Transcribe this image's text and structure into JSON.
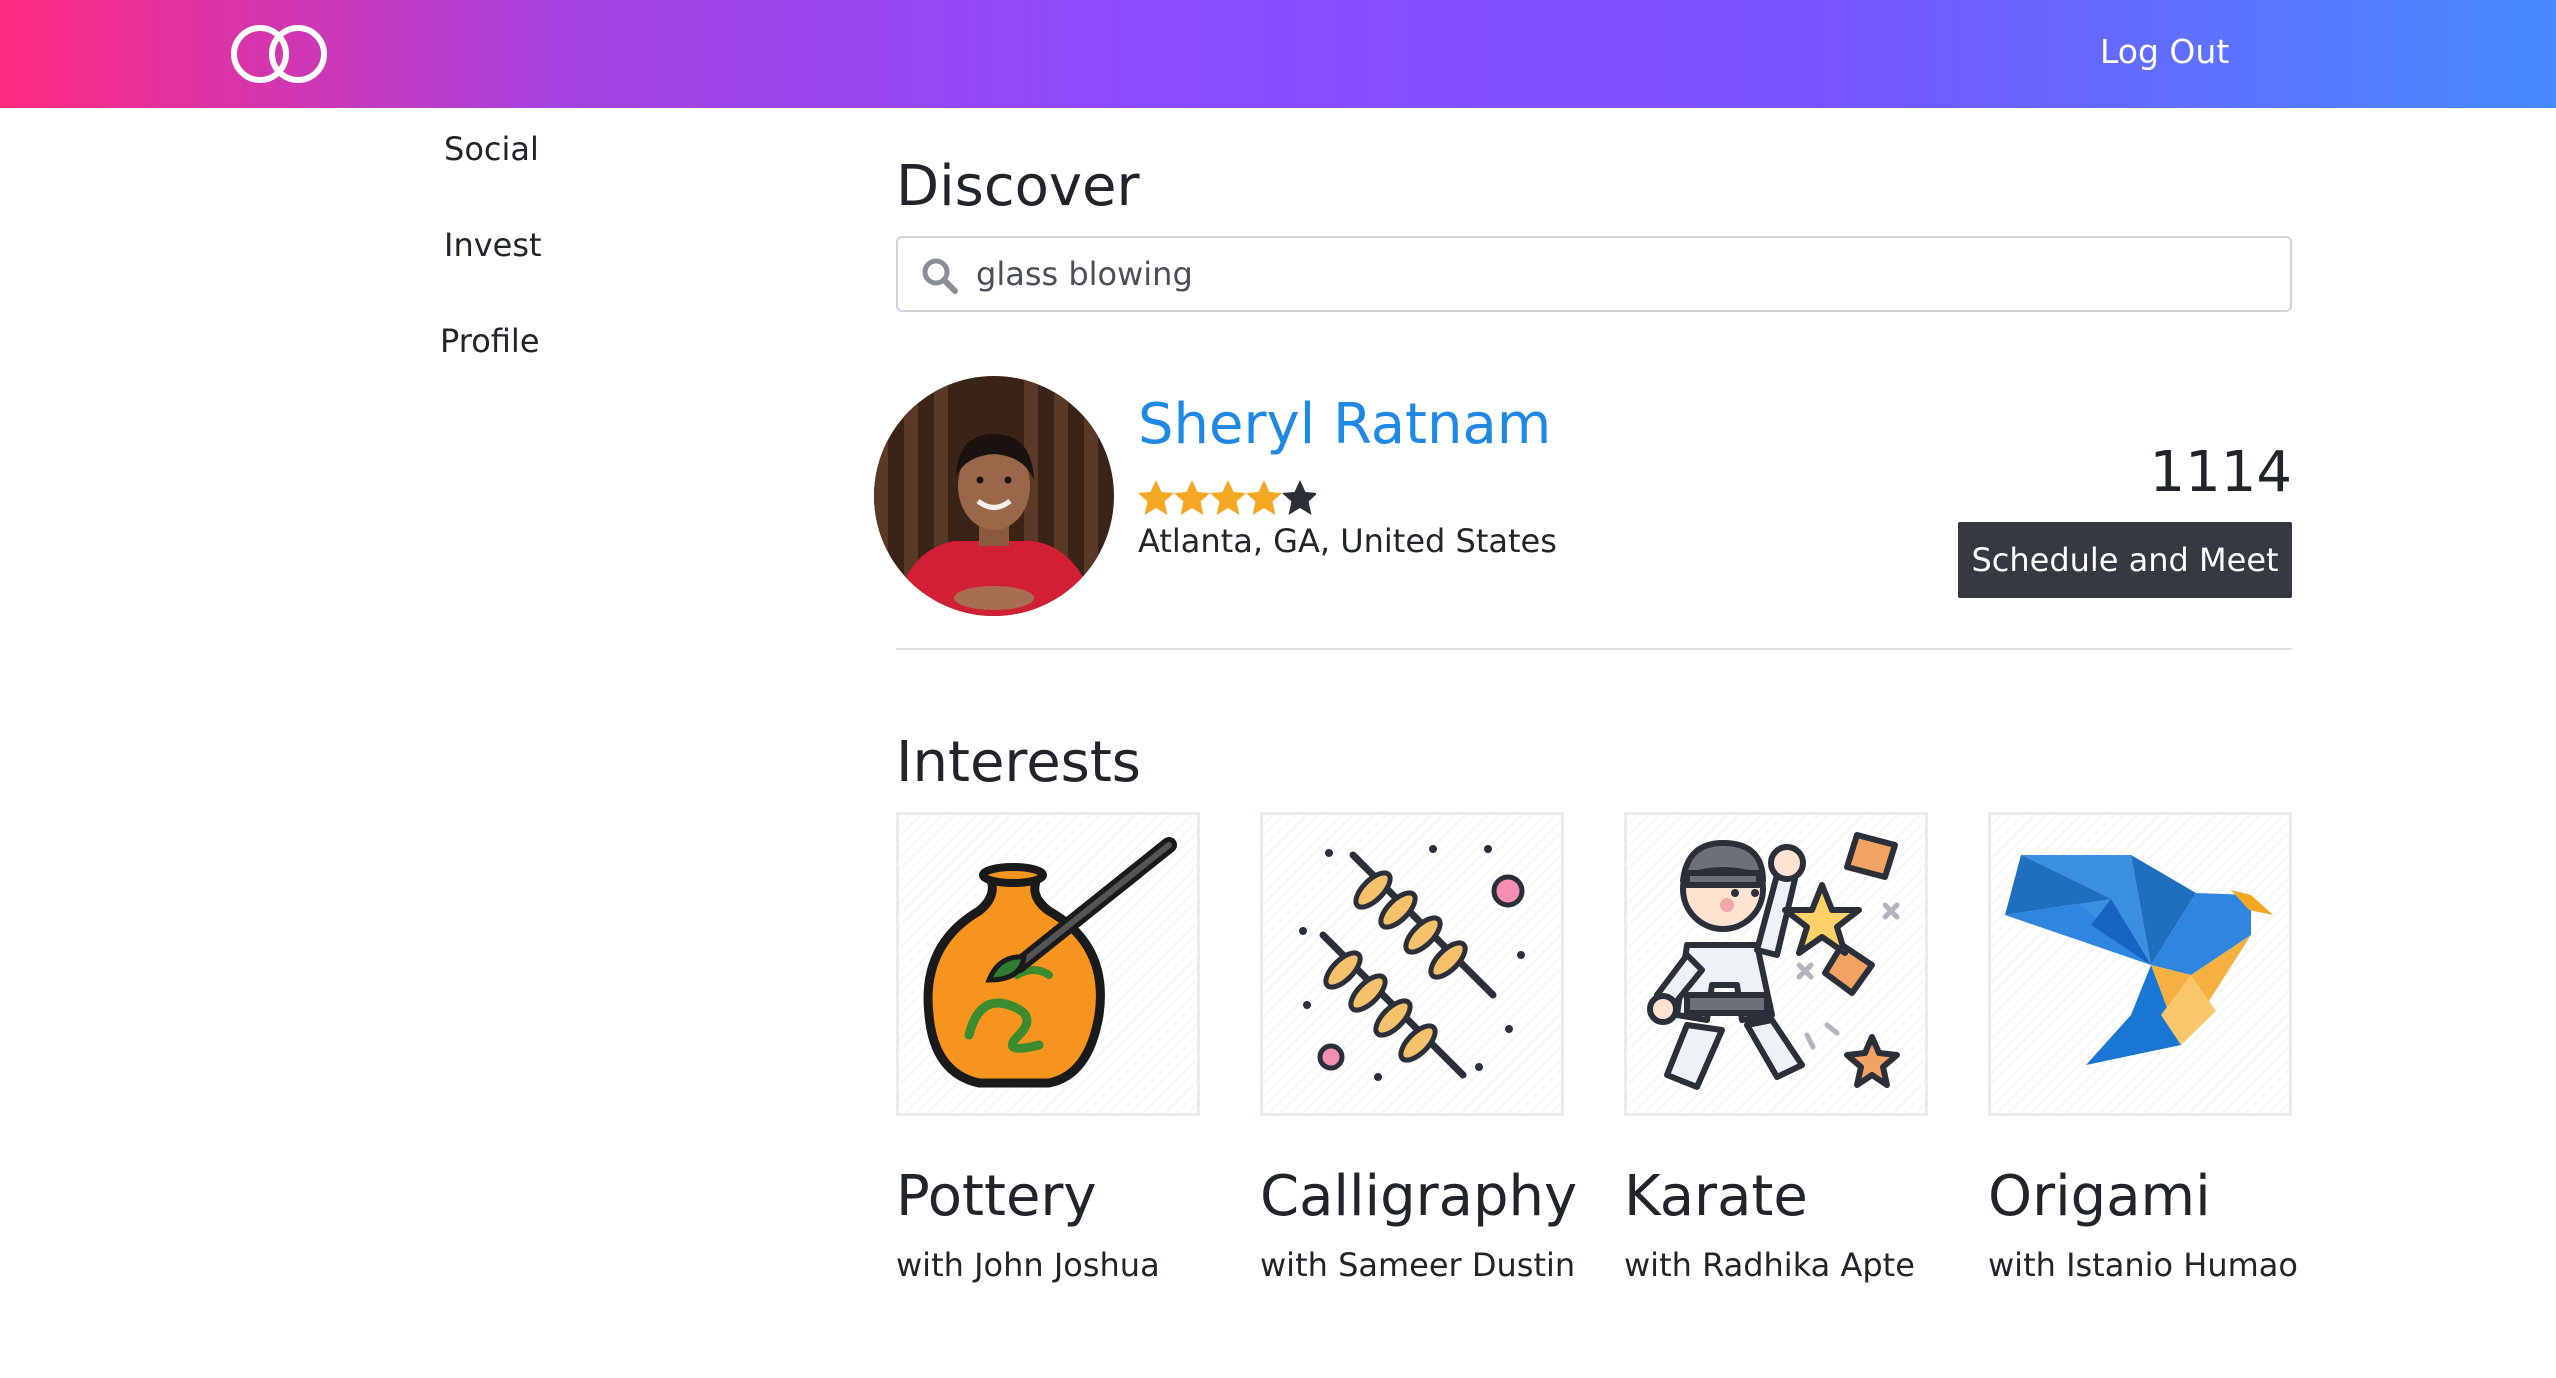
{
  "header": {
    "logout_label": "Log Out"
  },
  "sidebar": {
    "items": [
      {
        "label": "Social"
      },
      {
        "label": "Invest"
      },
      {
        "label": "Profile"
      }
    ]
  },
  "main": {
    "title": "Discover",
    "search": {
      "value": "glass blowing",
      "icon": "search-icon"
    },
    "result": {
      "name": "Sheryl Ratnam",
      "rating": 4,
      "rating_max": 5,
      "location": "Atlanta, GA, United States",
      "count": "1114",
      "action_label": "Schedule and Meet"
    },
    "interests_title": "Interests",
    "interests": [
      {
        "title": "Pottery",
        "subtitle": "with John Joshua",
        "icon": "pottery-icon"
      },
      {
        "title": "Calligraphy",
        "subtitle": "with Sameer Dustin",
        "icon": "calligraphy-icon"
      },
      {
        "title": "Karate",
        "subtitle": "with Radhika Apte",
        "icon": "karate-icon"
      },
      {
        "title": "Origami",
        "subtitle": "with Istanio Humao",
        "icon": "origami-icon"
      }
    ]
  },
  "colors": {
    "header_gradient": [
      "#ff2a7f",
      "#8c4bff",
      "#468bff"
    ],
    "name_link": "#1e88e5",
    "star_filled": "#f5a623",
    "star_empty": "#2b2f36",
    "button_dark": "#343a40"
  }
}
